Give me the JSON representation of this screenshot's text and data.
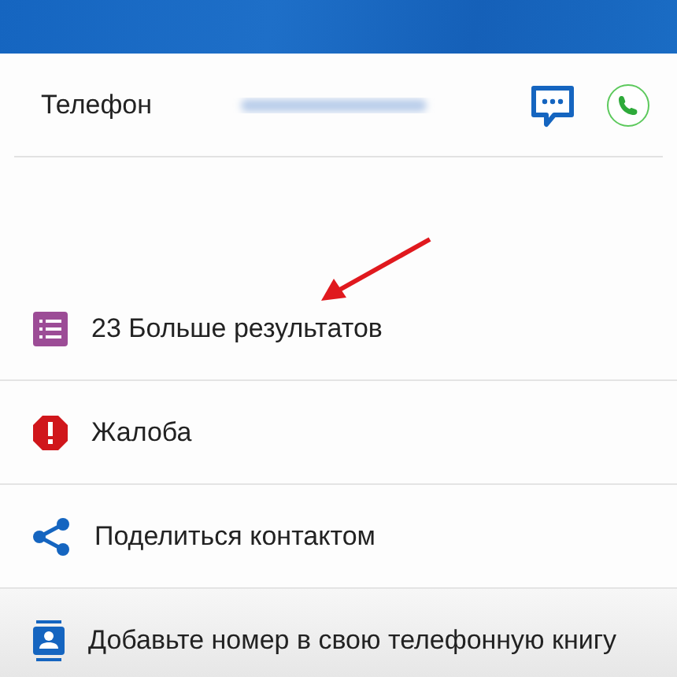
{
  "phone": {
    "label": "Телефон"
  },
  "actions": [
    {
      "kind": "list",
      "label": "23 Больше результатов"
    },
    {
      "kind": "alert",
      "label": "Жалоба"
    },
    {
      "kind": "share",
      "label": "Поделиться контактом"
    },
    {
      "kind": "contact",
      "label": "Добавьте номер в свою телефонную книгу"
    }
  ]
}
